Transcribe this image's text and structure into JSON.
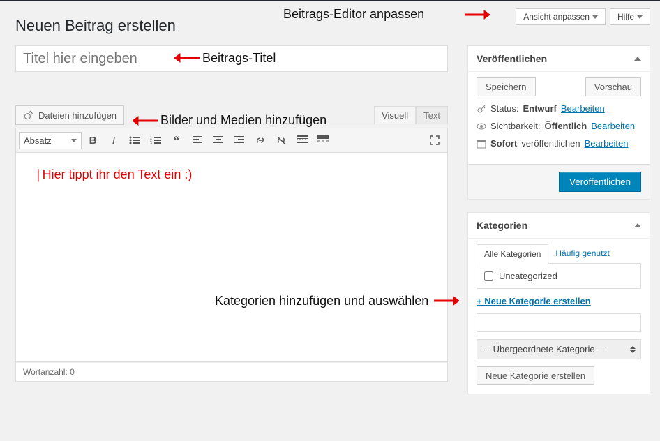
{
  "top": {
    "ansicht": "Ansicht anpassen",
    "hilfe": "Hilfe"
  },
  "page_title": "Neuen Beitrag erstellen",
  "title_placeholder": "Titel hier eingeben",
  "media_btn": "Dateien hinzufügen",
  "tabs": {
    "visual": "Visuell",
    "text": "Text"
  },
  "toolbar": {
    "format": "Absatz"
  },
  "editor_sample": "Hier tippt ihr den Text ein :)",
  "wordcount": "Wortanzahl: 0",
  "publish": {
    "title": "Veröffentlichen",
    "save": "Speichern",
    "preview": "Vorschau",
    "status_label": "Status:",
    "status_value": "Entwurf",
    "visibility_label": "Sichtbarkeit:",
    "visibility_value": "Öffentlich",
    "schedule_prefix": "Sofort",
    "schedule_suffix": "veröffentlichen",
    "edit": "Bearbeiten",
    "submit": "Veröffentlichen"
  },
  "categories": {
    "title": "Kategorien",
    "tab_all": "Alle Kategorien",
    "tab_freq": "Häufig genutzt",
    "items": [
      {
        "label": "Uncategorized"
      }
    ],
    "add_link": "+ Neue Kategorie erstellen",
    "parent_placeholder": "— Übergeordnete Kategorie —",
    "add_btn": "Neue Kategorie erstellen"
  },
  "annot": {
    "editor_anpassen": "Beitrags-Editor anpassen",
    "beitrags_titel": "Beitrags-Titel",
    "bilder_medien": "Bilder und Medien hinzufügen",
    "kategorien": "Kategorien hinzufügen und auswählen"
  }
}
